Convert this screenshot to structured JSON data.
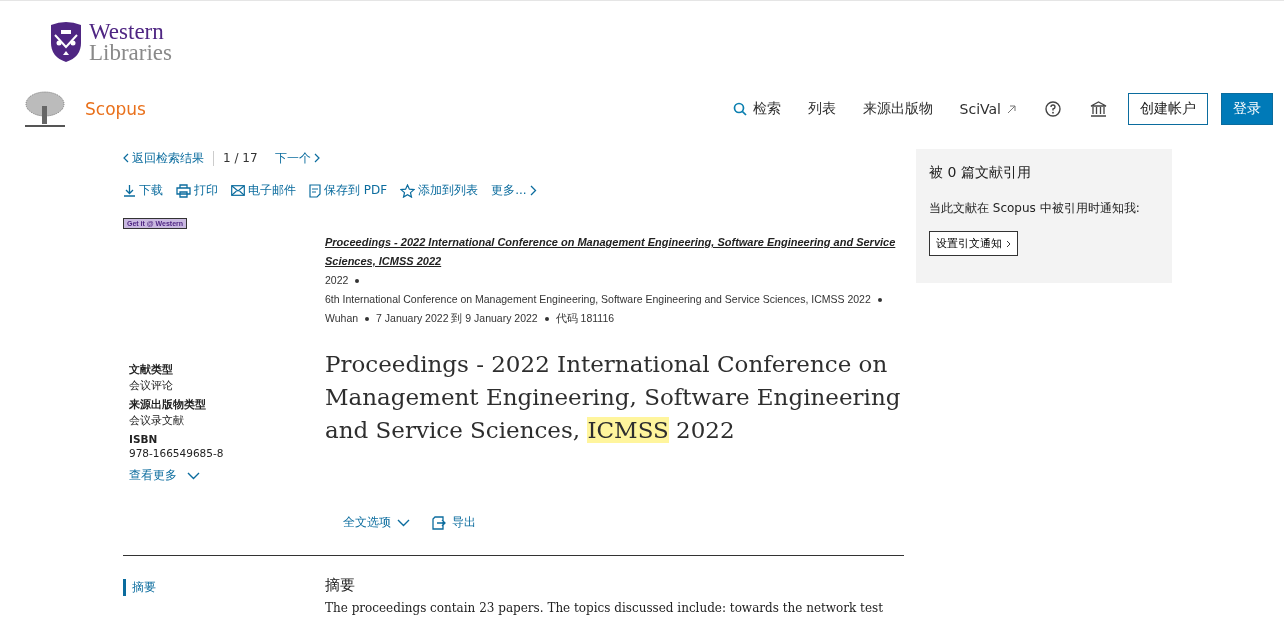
{
  "library_logo": {
    "line1": "Western",
    "line2": "Libraries"
  },
  "brand": {
    "name": "Scopus"
  },
  "nav": [
    {
      "kind": "search",
      "label": "检索"
    },
    {
      "kind": "plain",
      "label": "列表"
    },
    {
      "kind": "plain",
      "label": "来源出版物"
    },
    {
      "kind": "external",
      "label": "SciVal"
    }
  ],
  "account_buttons": [
    {
      "label": "创建帐户",
      "kind": "outline"
    },
    {
      "label": "登录",
      "kind": "primary"
    }
  ],
  "pager": {
    "back": "返回检索结果",
    "current": "1",
    "separator": "/",
    "total": "17",
    "next": "下一个"
  },
  "actions": [
    {
      "kind": "download",
      "label": "下载"
    },
    {
      "kind": "print",
      "label": "打印"
    },
    {
      "kind": "email",
      "label": "电子邮件"
    },
    {
      "kind": "pdf",
      "label": "保存到 PDF"
    },
    {
      "kind": "star",
      "label": "添加到列表"
    },
    {
      "kind": "more",
      "label": "更多..."
    }
  ],
  "getit_badge": "Get it @ Western",
  "source": {
    "title": "Proceedings - 2022 International Conference on Management Engineering, Software Engineering and Service Sciences, ICMSS 2022",
    "meta": [
      "2022",
      "6th International Conference on Management Engineering, Software Engineering and Service Sciences, ICMSS 2022",
      "Wuhan",
      "7 January 2022 到 9 January 2022",
      "代码 181116"
    ]
  },
  "details": [
    {
      "label": "文献类型",
      "value": "会议评论"
    },
    {
      "label": "来源出版物类型",
      "value": "会议录文献"
    },
    {
      "label": "ISBN",
      "value": "978-166549685-8"
    }
  ],
  "see_more": "查看更多",
  "title_parts": [
    {
      "text": "Proceedings - 2022 International Conference on Management Engineering, Software Engineering and Service Sciences, ",
      "highlighted": false
    },
    {
      "text": "ICMSS",
      "highlighted": true
    },
    {
      "text": " 2022",
      "highlighted": false
    }
  ],
  "doc_actions": [
    {
      "kind": "dropdown",
      "label": "全文选项"
    },
    {
      "kind": "export",
      "label": "导出"
    }
  ],
  "section_nav": [
    {
      "label": "摘要",
      "selected": true
    }
  ],
  "abstract": {
    "heading": "摘要",
    "text": "The proceedings contain 23 papers. The topics discussed include: towards the network test"
  },
  "cited_by": {
    "title": "被 0 篇文献引用",
    "note": "当此文献在 Scopus 中被引用时通知我:",
    "button": "设置引文通知"
  }
}
